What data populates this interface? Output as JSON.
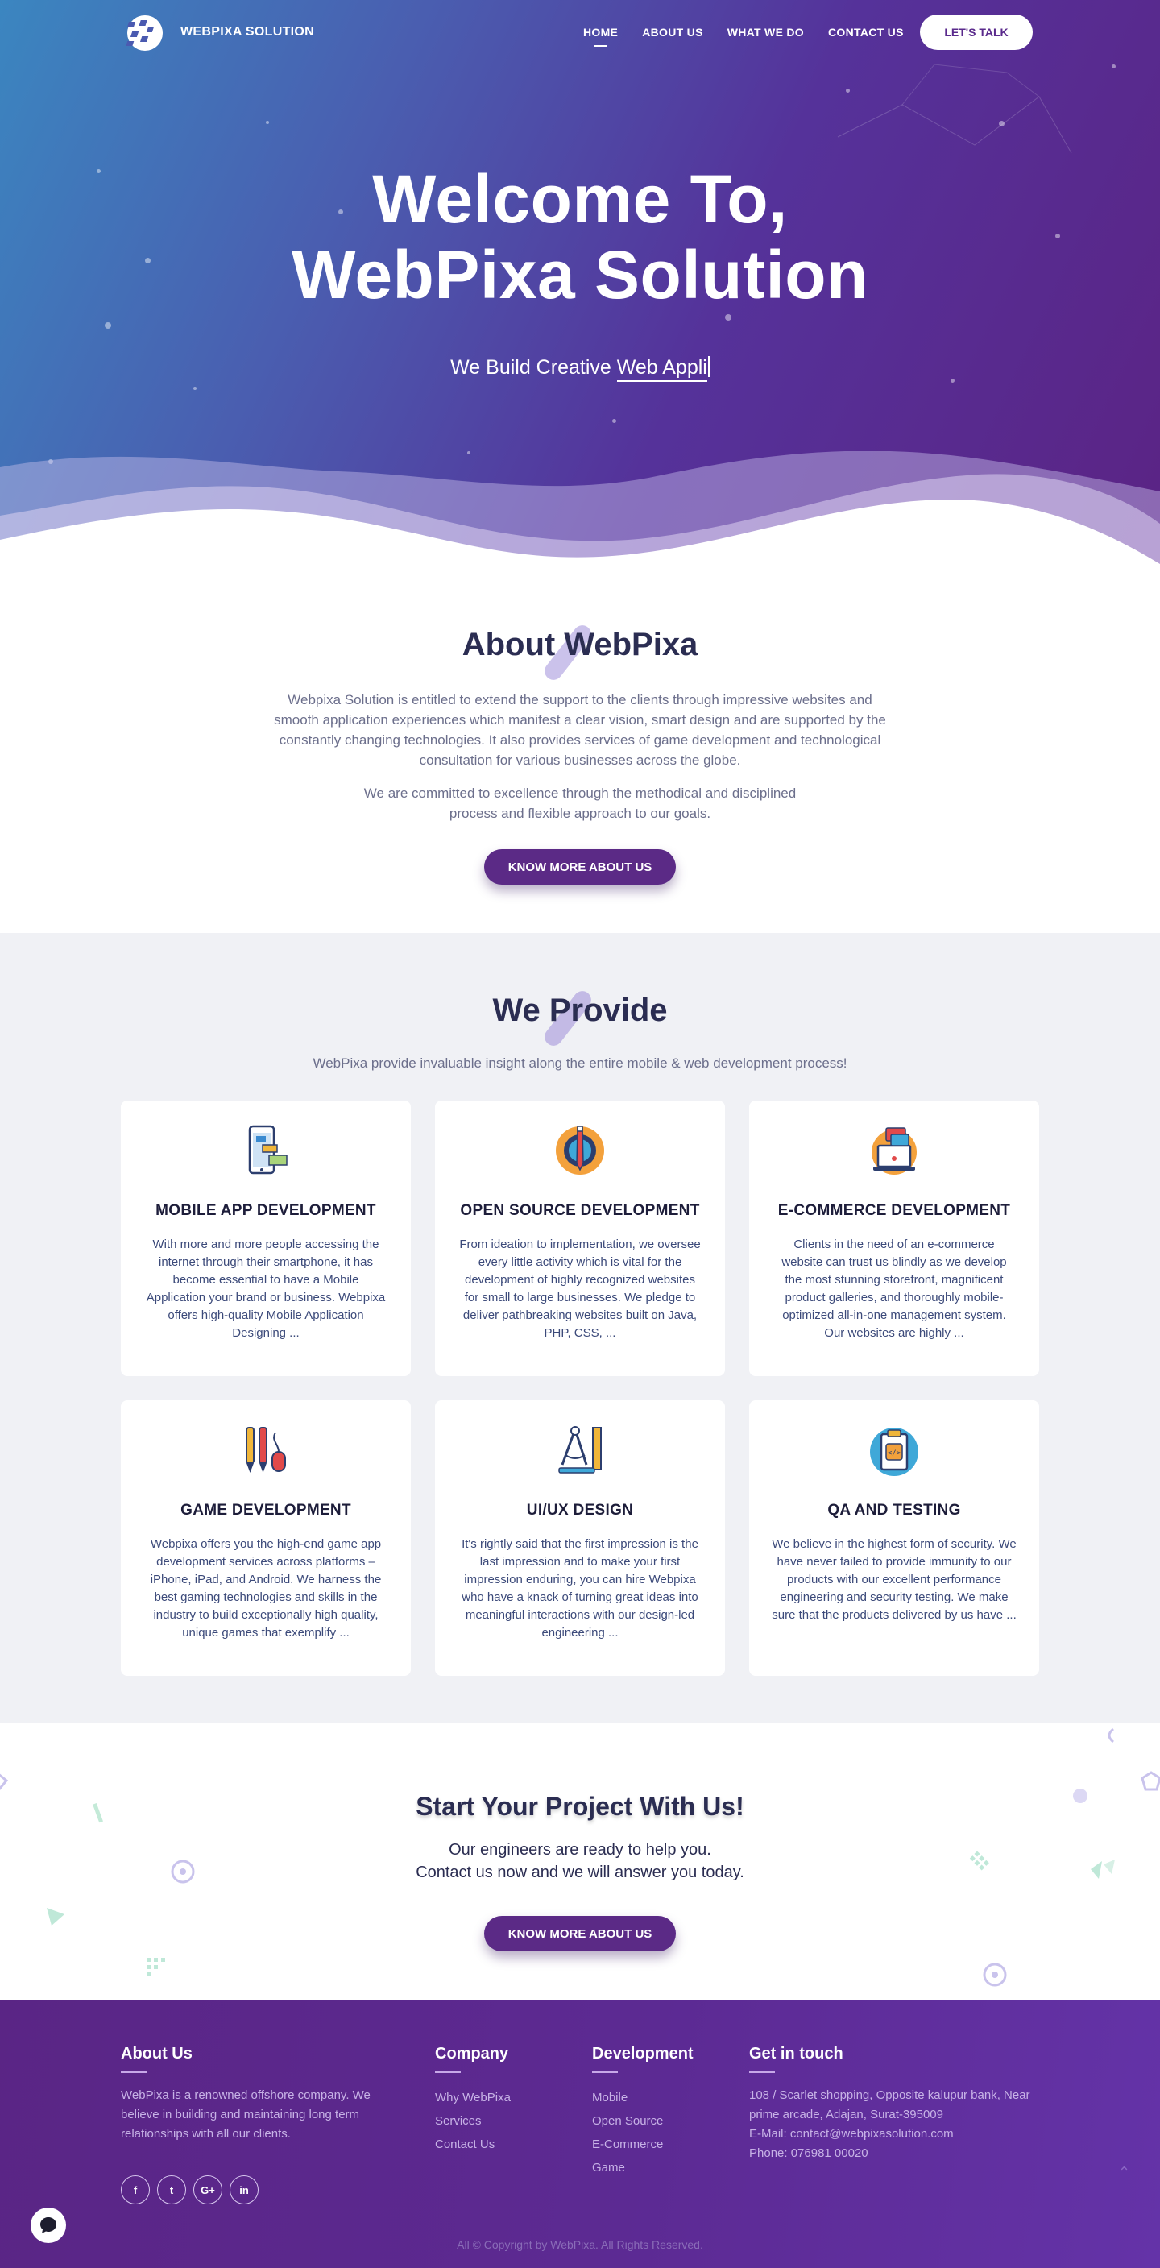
{
  "nav": {
    "logo_text": "WEBPIXA SOLUTION",
    "links": [
      "HOME",
      "ABOUT US",
      "WHAT WE DO",
      "CONTACT US"
    ],
    "cta_label": "LET'S TALK"
  },
  "hero": {
    "title_line1": "Welcome To,",
    "title_line2": "WebPixa Solution",
    "subtitle_prefix": "We Build Creative ",
    "subtitle_typed": "Web Appli"
  },
  "about": {
    "title": "About WebPixa",
    "paragraph1": "Webpixa Solution is entitled to extend the support to the clients through impressive websites and smooth application experiences which manifest a clear vision, smart design and are supported by the constantly changing technologies. It also provides services of game development and technological consultation for various businesses across the globe.",
    "paragraph2": "We are committed to excellence through the methodical and disciplined process and flexible approach to our goals.",
    "button_label": "KNOW MORE ABOUT US"
  },
  "services": {
    "title": "We Provide",
    "subtitle": "WebPixa provide invaluable insight along the entire mobile & web development process!",
    "cards": [
      {
        "icon": "mobile-app-icon",
        "title": "MOBILE APP DEVELOPMENT",
        "text": "With more and more people accessing the internet through their smartphone, it has become essential to have a Mobile Application your brand or business. Webpixa offers high-quality Mobile Application Designing ..."
      },
      {
        "icon": "open-source-gear-icon",
        "title": "OPEN SOURCE DEVELOPMENT",
        "text": "From ideation to implementation, we oversee every little activity which is vital for the development of highly recognized websites for small to large businesses. We pledge to deliver pathbreaking websites built on Java, PHP, CSS, ..."
      },
      {
        "icon": "ecommerce-laptop-icon",
        "title": "E-COMMERCE DEVELOPMENT",
        "text": "Clients in the need of an e-commerce website can trust us blindly as we develop the most stunning storefront, magnificent product galleries, and thoroughly mobile-optimized all-in-one management system. Our websites are highly ..."
      },
      {
        "icon": "game-tools-icon",
        "title": "GAME DEVELOPMENT",
        "text": "Webpixa offers you the high-end game app development services across platforms – iPhone, iPad, and Android. We harness the best gaming technologies and skills in the industry to build exceptionally high quality, unique games that exemplify ..."
      },
      {
        "icon": "design-compass-icon",
        "title": "UI/UX DESIGN",
        "text": "It's rightly said that the first impression is the last impression and to make your first impression enduring, you can hire Webpixa who have a knack of turning great ideas into meaningful interactions with our design-led engineering ..."
      },
      {
        "icon": "qa-clipboard-icon",
        "title": "QA AND TESTING",
        "text": "We believe in the highest form of security. We have never failed to provide immunity to our products with our excellent performance engineering and security testing. We make sure that the products delivered by us have ..."
      }
    ]
  },
  "cta": {
    "title": "Start Your Project With Us!",
    "line1": "Our engineers are ready to help you.",
    "line2": "Contact us now and we will answer you today.",
    "button_label": "KNOW MORE ABOUT US"
  },
  "footer": {
    "about_title": "About Us",
    "about_text": "WebPixa is a renowned offshore company. We believe in building and maintaining long term relationships with all our clients.",
    "company_title": "Company",
    "company_links": [
      "Why WebPixa",
      "Services",
      "Contact Us"
    ],
    "development_title": "Development",
    "development_links": [
      "Mobile",
      "Open Source",
      "E-Commerce",
      "Game"
    ],
    "contact_title": "Get in touch",
    "address": "108 / Scarlet shopping, Opposite kalupur bank, Near prime arcade, Adajan, Surat-395009",
    "email": "E-Mail: contact@webpixasolution.com",
    "phone": "Phone: 076981 00020",
    "social": [
      "f",
      "t",
      "G+",
      "in"
    ],
    "copyright": "All © Copyright by WebPixa. All Rights Reserved."
  },
  "colors": {
    "brand_purple": "#5b2a86",
    "hero_blue": "#3b86c0",
    "heading_navy": "#2b2d52"
  }
}
